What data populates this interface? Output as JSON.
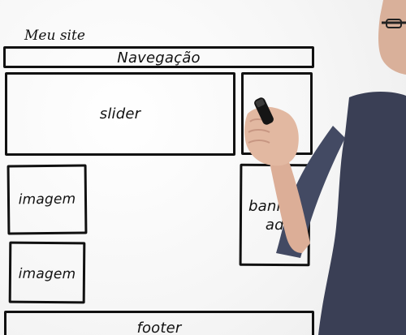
{
  "site_title": "Meu site",
  "wireframe": {
    "navigation": "Navegação",
    "slider": "slider",
    "image_1": "imagem",
    "image_2": "imagem",
    "banner_line1": "banner",
    "banner_line2": "ad",
    "footer": "footer"
  },
  "colors": {
    "ink": "#111111",
    "glass_background": "#f3f3f3",
    "shirt": "#3a3f55",
    "skin": "#e2b8a1"
  }
}
